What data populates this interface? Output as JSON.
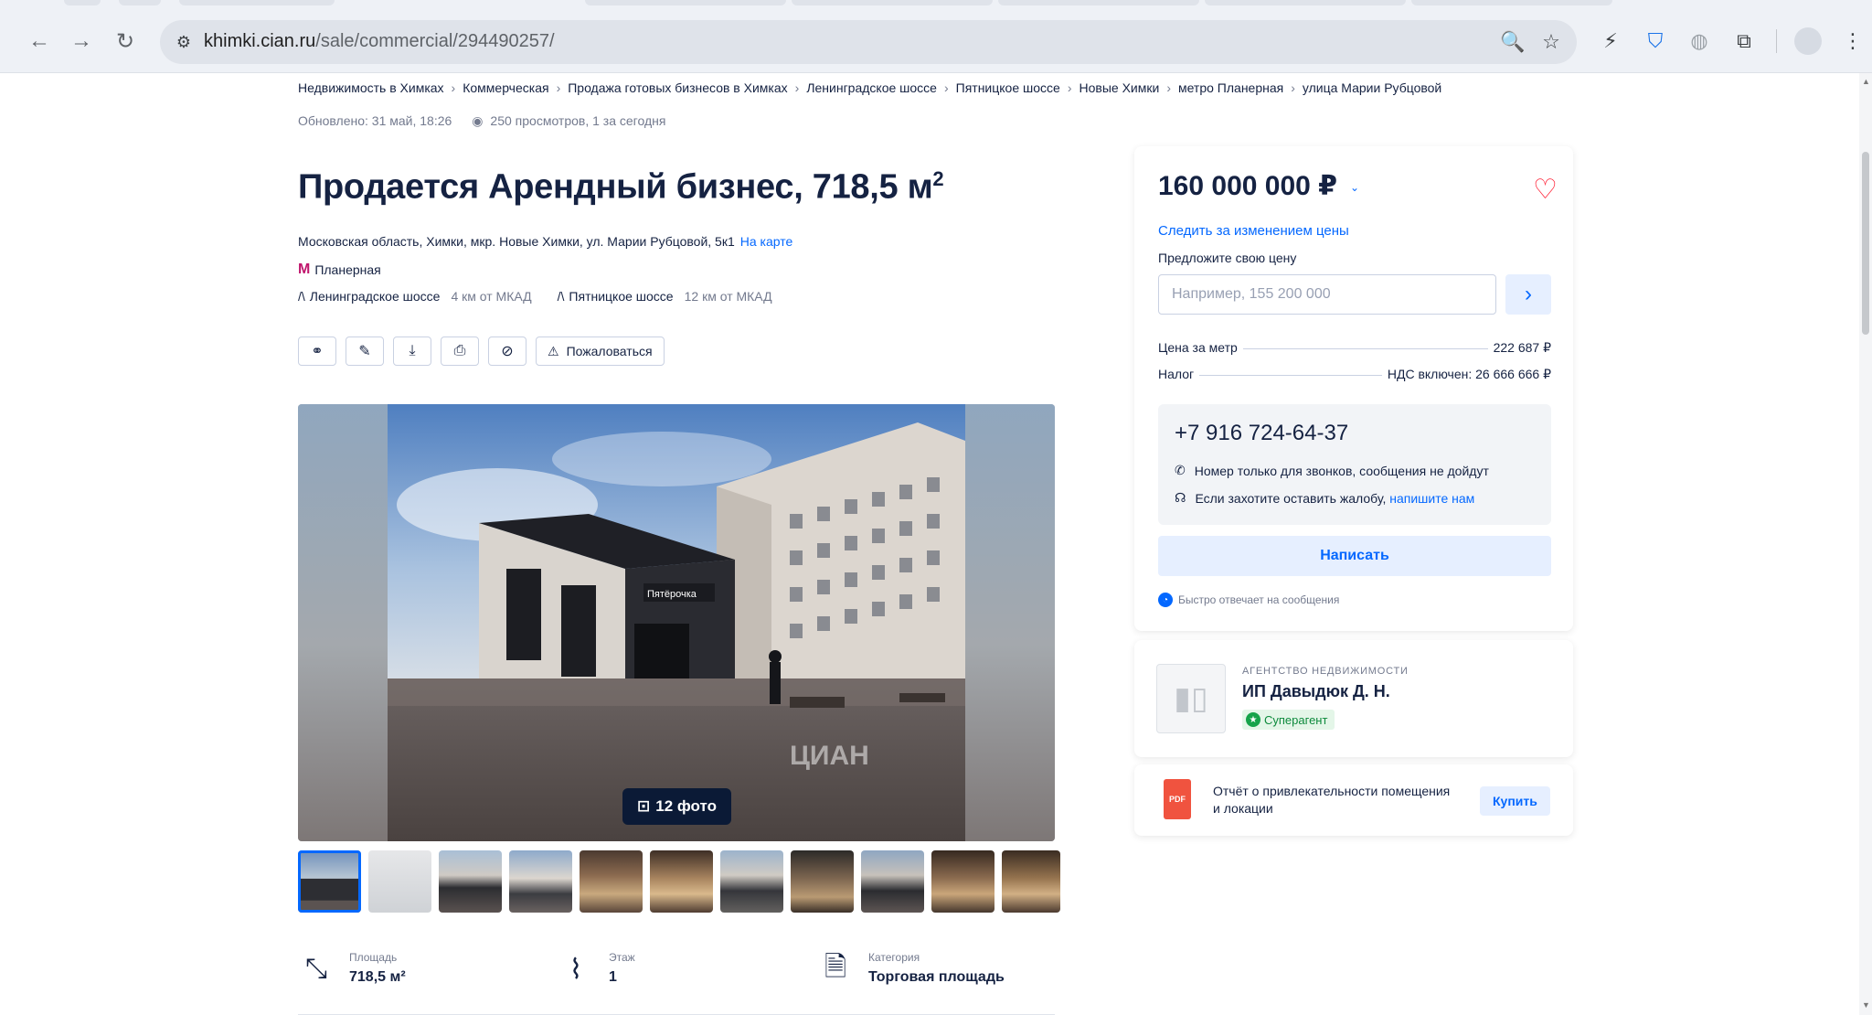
{
  "browser": {
    "url_host": "khimki.cian.ru",
    "url_path": "/sale/commercial/294490257/"
  },
  "breadcrumbs": [
    "Недвижимость в Химках",
    "Коммерческая",
    "Продажа готовых бизнесов в Химках",
    "Ленинградское шоссе",
    "Пятницкое шоссе",
    "Новые Химки",
    "метро Планерная",
    "улица Марии Рубцовой"
  ],
  "meta": {
    "updated": "Обновлено: 31 май, 18:26",
    "views": "250 просмотров, 1 за сегодня"
  },
  "listing": {
    "title": "Продается Арендный бизнес, 718,5 м",
    "title_sup": "2",
    "address": "Московская область, Химки, мкр. Новые Химки, ул. Марии Рубцовой, 5к1",
    "map_link": "На карте",
    "metro": "Планерная",
    "highways": [
      {
        "name": "Ленинградское шоссе",
        "distance": "4 км от МКАД"
      },
      {
        "name": "Пятницкое шоссе",
        "distance": "12 км от МКАД"
      }
    ],
    "complain": "Пожаловаться",
    "photo_count": "12 фото",
    "watermark": "ЦИАН",
    "features": [
      {
        "label": "Площадь",
        "value": "718,5 м²"
      },
      {
        "label": "Этаж",
        "value": "1"
      },
      {
        "label": "Категория",
        "value": "Торговая площадь"
      }
    ]
  },
  "price_card": {
    "price": "160 000 000 ₽",
    "follow": "Следить за изменением цены",
    "offer_label": "Предложите свою цену",
    "offer_placeholder": "Например, 155 200 000",
    "per_meter_label": "Цена за метр",
    "per_meter_value": "222 687 ₽",
    "tax_label": "Налог",
    "tax_value": "НДС включен: 26 666 666 ₽",
    "phone": "+7 916 724-64-37",
    "note_calls": "Номер только для звонков, сообщения не дойдут",
    "note_complaint": "Если захотите оставить жалобу,",
    "note_complaint_link": "напишите нам",
    "write": "Написать",
    "fast": "Быстро отвечает на сообщения"
  },
  "agent": {
    "type": "АГЕНТСТВО НЕДВИЖИМОСТИ",
    "name": "ИП Давыдюк Д. Н.",
    "badge": "Суперагент"
  },
  "report": {
    "pdf": "PDF",
    "text": "Отчёт о привлекательности помещения и локации",
    "buy": "Купить"
  },
  "colors": {
    "accent": "#0468ff",
    "text": "#152242",
    "muted": "#737a8e",
    "favorite": "#ff1f34",
    "metro": "#c0156c",
    "super_agent": "#16a34a"
  }
}
